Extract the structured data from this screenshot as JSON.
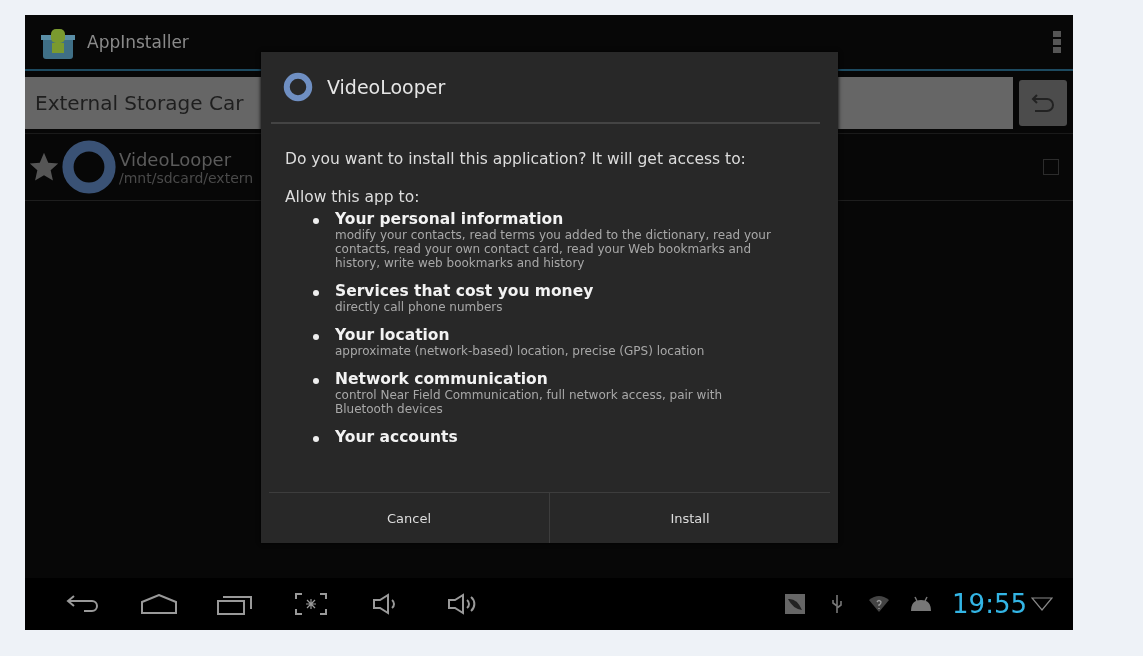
{
  "app_bar": {
    "title": "AppInstaller"
  },
  "path_bar": {
    "path": "External Storage Car"
  },
  "files": [
    {
      "name": "VideoLooper",
      "path": "/mnt/sdcard/extern",
      "checked": false
    }
  ],
  "dialog": {
    "title": "VideoLooper",
    "message": "Do you want to install this application? It will get access to:",
    "allow_label": "Allow this app to:",
    "permissions": [
      {
        "group": "Your personal information",
        "details": "modify your contacts, read terms you added to the dictionary, read your contacts, read your own contact card, read your Web bookmarks and history, write web bookmarks and history"
      },
      {
        "group": "Services that cost you money",
        "details": "directly call phone numbers"
      },
      {
        "group": "Your location",
        "details": "approximate (network-based) location, precise (GPS) location"
      },
      {
        "group": "Network communication",
        "details": "control Near Field Communication, full network access, pair with Bluetooth devices"
      },
      {
        "group": "Your accounts"
      }
    ],
    "buttons": [
      {
        "label": "Cancel"
      },
      {
        "label": "Install"
      }
    ]
  },
  "status_bar": {
    "time": "19:55"
  }
}
